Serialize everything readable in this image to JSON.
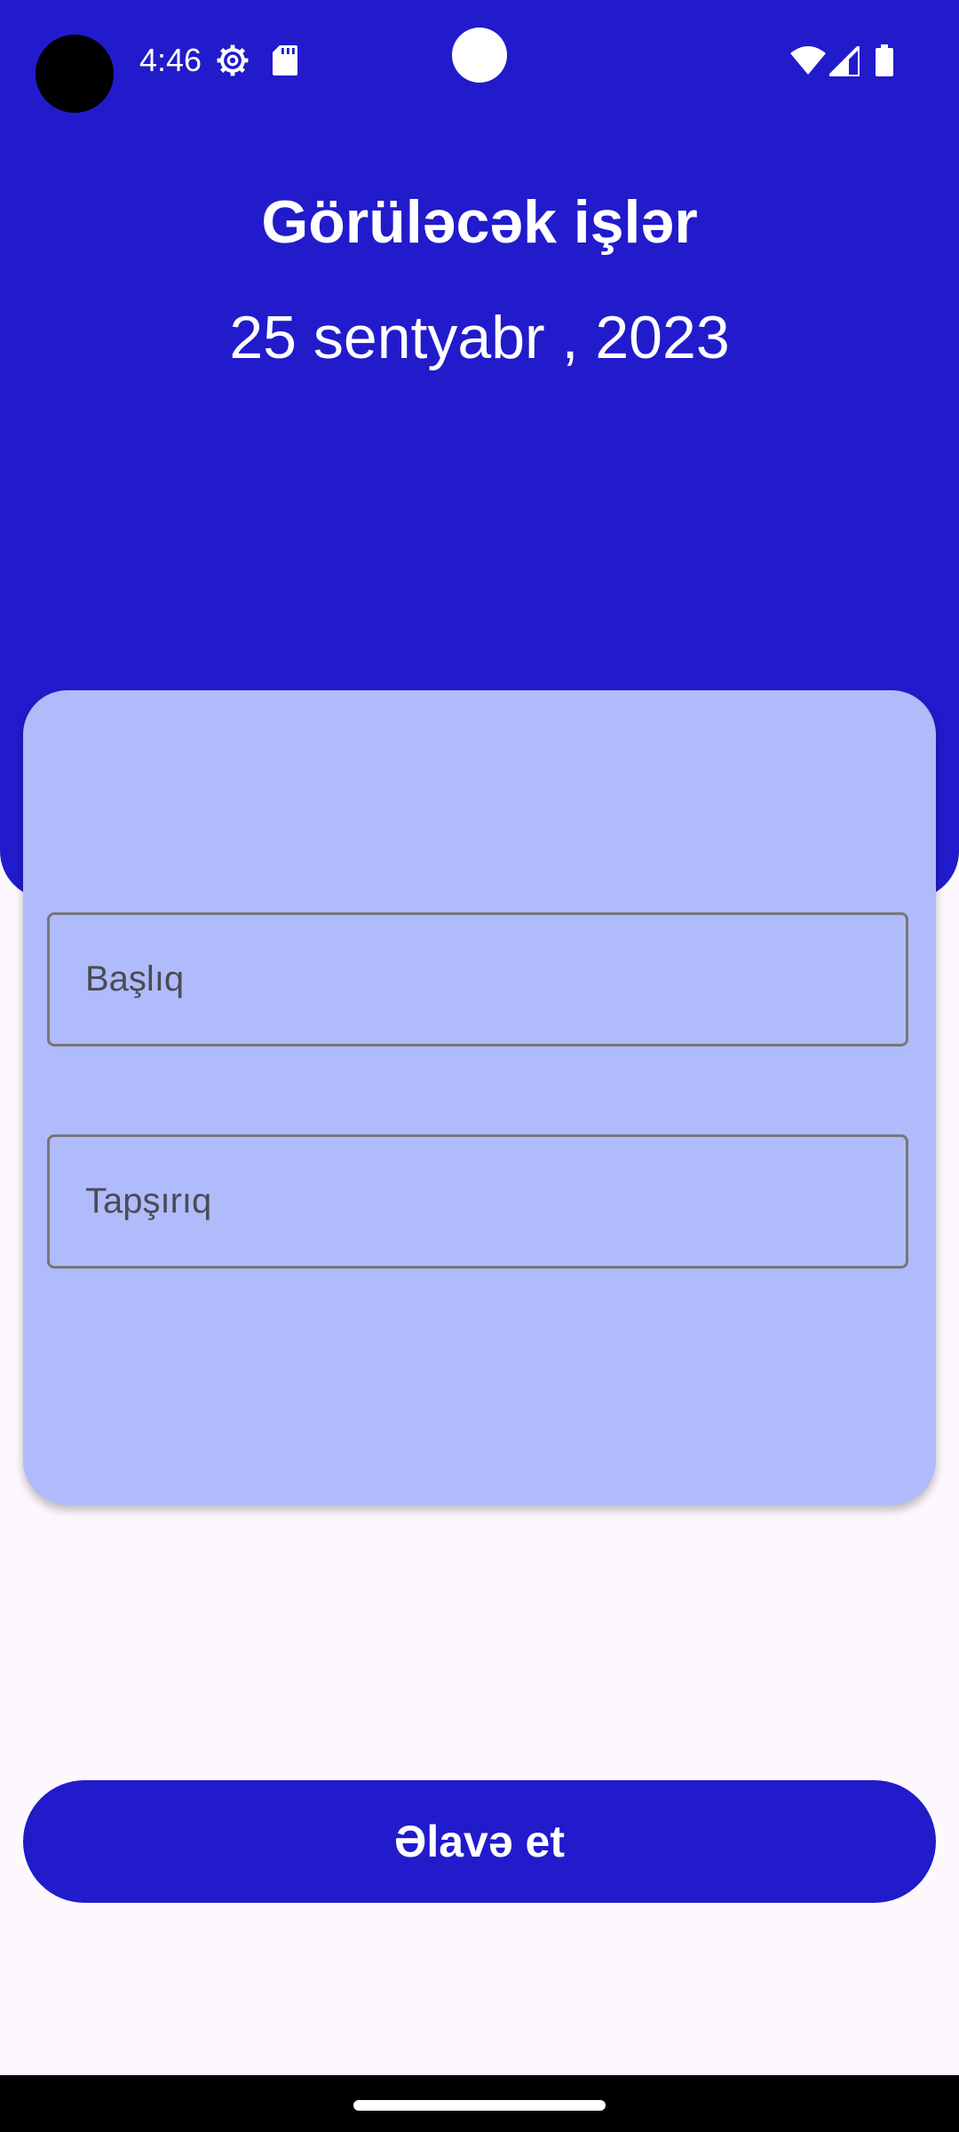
{
  "status_bar": {
    "time": "4:46",
    "icons": [
      "settings-icon",
      "sd-card-icon",
      "wifi-icon",
      "cell-signal-icon",
      "battery-icon"
    ]
  },
  "header": {
    "title": "Görüləcək işlər",
    "date": "25 sentyabr , 2023"
  },
  "form": {
    "title_placeholder": "Başlıq",
    "task_placeholder": "Tapşırıq"
  },
  "actions": {
    "add_label": "Əlavə et"
  },
  "colors": {
    "primary": "#211bcb",
    "card": "#b0bbfb",
    "background": "#fdf8fd"
  }
}
